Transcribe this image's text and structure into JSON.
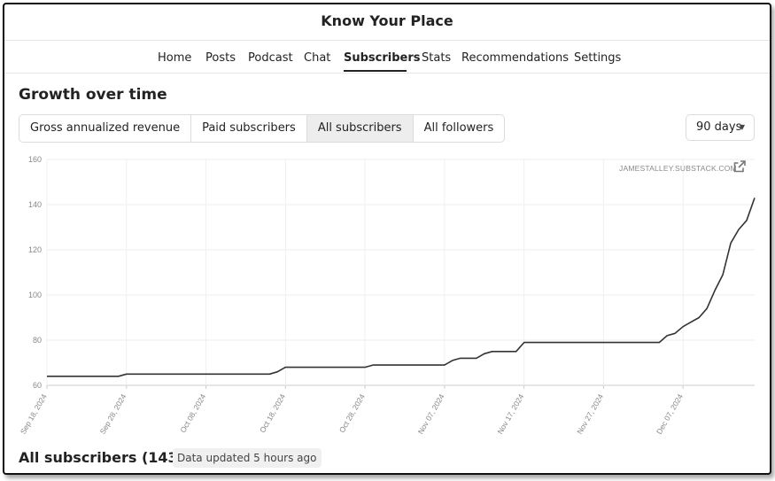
{
  "app": {
    "title": "Know Your Place"
  },
  "nav": {
    "items": [
      {
        "label": "Home"
      },
      {
        "label": "Posts"
      },
      {
        "label": "Podcast"
      },
      {
        "label": "Chat"
      },
      {
        "label": "Subscribers",
        "active": true
      },
      {
        "label": "Stats"
      },
      {
        "label": "Recommendations"
      },
      {
        "label": "Settings"
      }
    ]
  },
  "section": {
    "heading": "Growth over time"
  },
  "metric_tabs": [
    {
      "label": "Gross annualized revenue"
    },
    {
      "label": "Paid subscribers"
    },
    {
      "label": "All subscribers",
      "selected": true
    },
    {
      "label": "All followers"
    }
  ],
  "range": {
    "value": "90 days"
  },
  "watermark": {
    "text": "JAMESTALLEY.SUBSTACK.COM",
    "icon": "external-link-icon"
  },
  "chart_data": {
    "type": "line",
    "title": "",
    "xlabel": "",
    "ylabel": "",
    "ylim": [
      60,
      160
    ],
    "y_ticks": [
      "60",
      "80",
      "100",
      "120",
      "140",
      "160"
    ],
    "x_ticks": [
      "Sep 18, 2024",
      "Sep 28, 2024",
      "Oct 08, 2024",
      "Oct 18, 2024",
      "Oct 28, 2024",
      "Nov 07, 2024",
      "Nov 17, 2024",
      "Nov 27, 2024",
      "Dec 07, 2024"
    ],
    "grid": true,
    "line_color": "#333333",
    "series": [
      {
        "x": [
          "2024-09-18",
          "2024-09-27",
          "2024-09-28",
          "2024-10-16",
          "2024-10-17",
          "2024-10-18",
          "2024-10-28",
          "2024-10-29",
          "2024-11-07",
          "2024-11-08",
          "2024-11-09",
          "2024-11-11",
          "2024-11-12",
          "2024-11-13",
          "2024-11-16",
          "2024-11-17",
          "2024-12-04",
          "2024-12-05",
          "2024-12-06",
          "2024-12-07",
          "2024-12-08",
          "2024-12-09",
          "2024-12-10",
          "2024-12-11",
          "2024-12-12",
          "2024-12-13",
          "2024-12-14",
          "2024-12-15",
          "2024-12-16"
        ],
        "y": [
          64,
          64,
          65,
          65,
          66,
          68,
          68,
          69,
          69,
          71,
          72,
          72,
          74,
          75,
          75,
          79,
          79,
          82,
          83,
          86,
          88,
          90,
          94,
          102,
          109,
          123,
          129,
          133,
          143
        ]
      }
    ]
  },
  "footer": {
    "title": "All subscribers (143)",
    "updated": "Data updated 5 hours ago"
  }
}
